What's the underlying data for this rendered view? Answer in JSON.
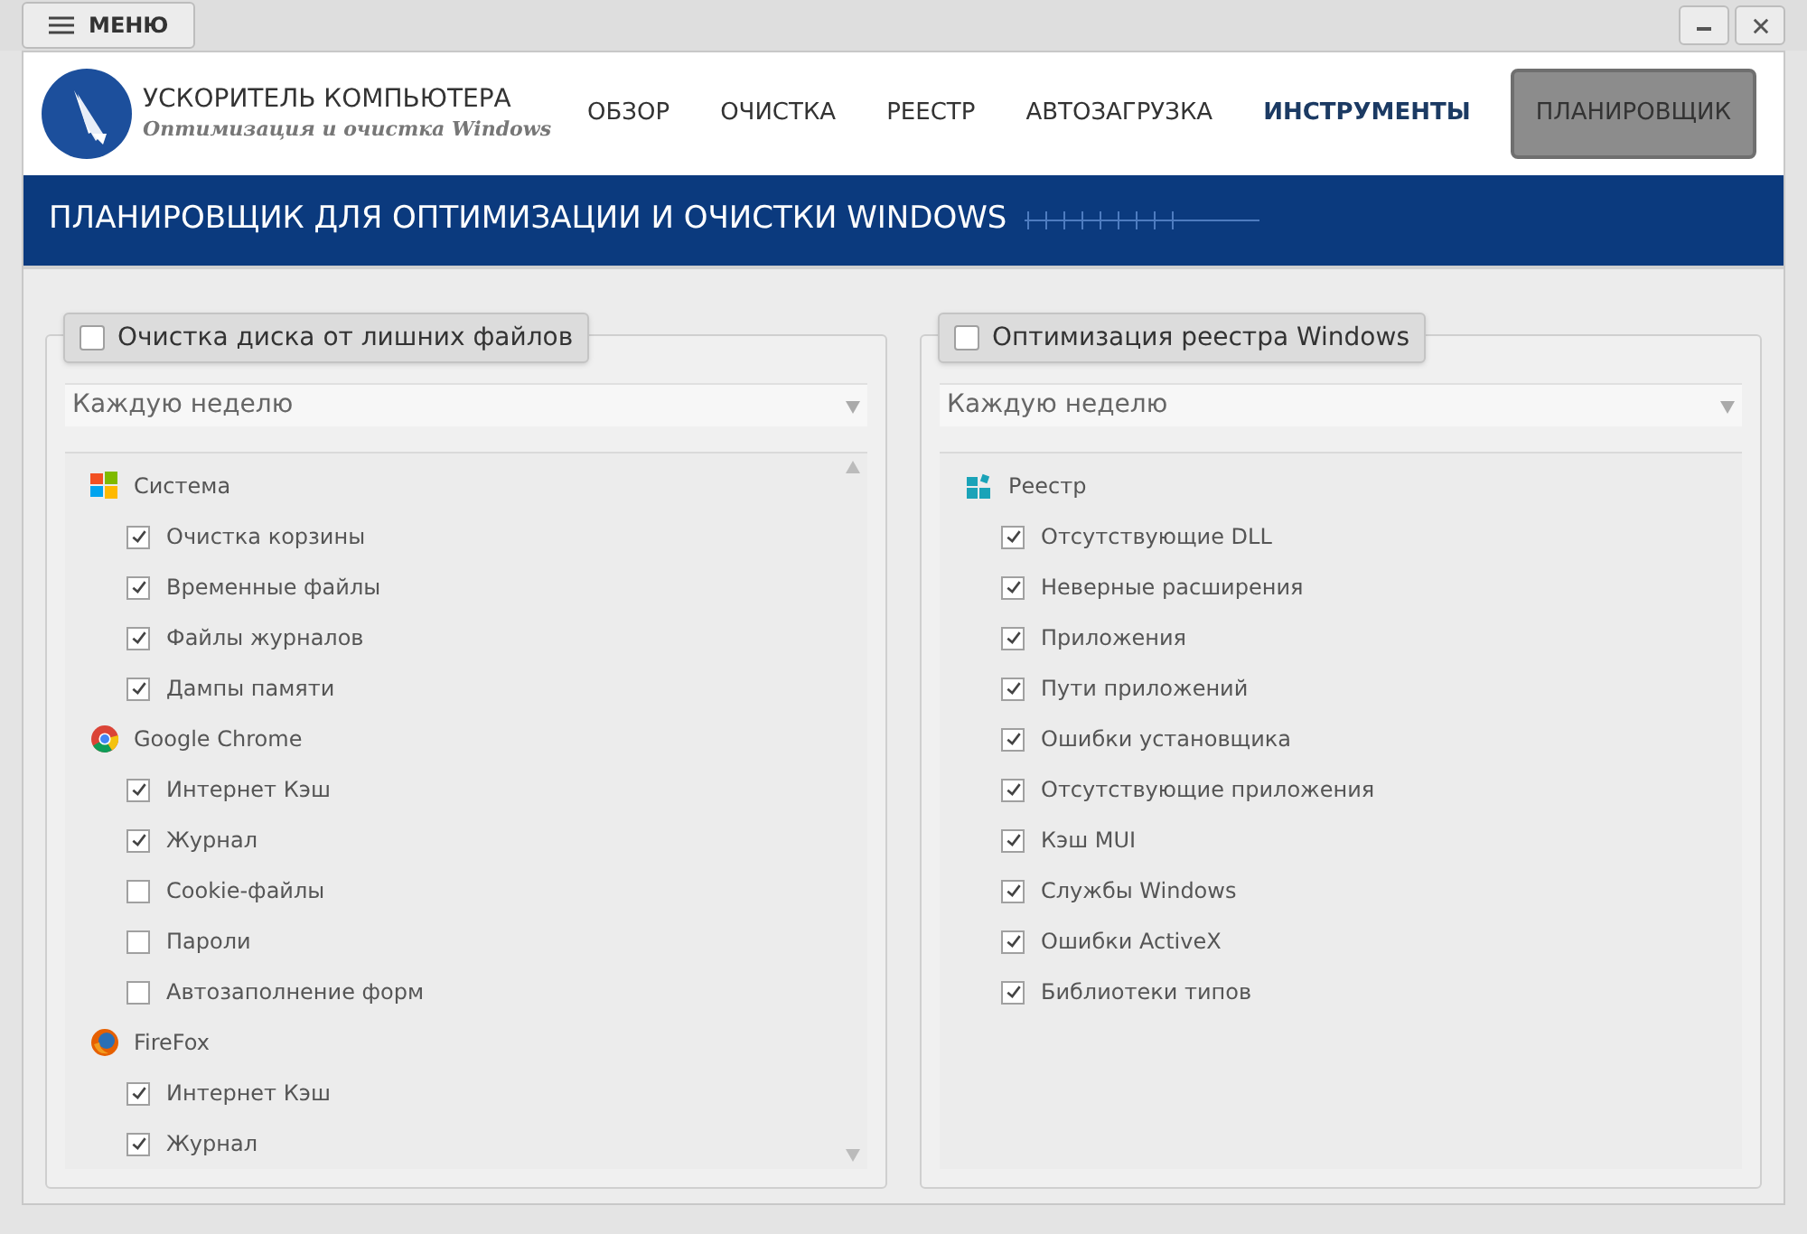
{
  "menu_button": {
    "label": "МЕНЮ"
  },
  "app": {
    "name": "УСКОРИТЕЛЬ КОМПЬЮТЕРА",
    "tagline": "Оптимизация и очистка Windows"
  },
  "nav": [
    {
      "label": "ОБЗОР",
      "selected": false,
      "highlighted": false
    },
    {
      "label": "ОЧИСТКА",
      "selected": false,
      "highlighted": false
    },
    {
      "label": "РЕЕСТР",
      "selected": false,
      "highlighted": false
    },
    {
      "label": "АВТОЗАГРУЗКА",
      "selected": false,
      "highlighted": false
    },
    {
      "label": "ИНСТРУМЕНТЫ",
      "selected": false,
      "highlighted": true
    },
    {
      "label": "ПЛАНИРОВЩИК",
      "selected": true,
      "highlighted": false
    }
  ],
  "banner": {
    "title": "ПЛАНИРОВЩИК ДЛЯ ОПТИМИЗАЦИИ И ОЧИСТКИ WINDOWS"
  },
  "panels": [
    {
      "title": "Очистка диска от лишних файлов",
      "checked": false,
      "schedule": "Каждую неделю",
      "scrollable": true,
      "groups": [
        {
          "name": "Система",
          "kind": "windows",
          "items": [
            {
              "label": "Очистка корзины",
              "checked": true
            },
            {
              "label": "Временные файлы",
              "checked": true
            },
            {
              "label": "Файлы журналов",
              "checked": true
            },
            {
              "label": "Дампы памяти",
              "checked": true
            }
          ]
        },
        {
          "name": "Google Chrome",
          "kind": "chrome",
          "items": [
            {
              "label": "Интернет Кэш",
              "checked": true
            },
            {
              "label": "Журнал",
              "checked": true
            },
            {
              "label": "Cookie-файлы",
              "checked": false
            },
            {
              "label": "Пароли",
              "checked": false
            },
            {
              "label": "Автозаполнение форм",
              "checked": false
            }
          ]
        },
        {
          "name": "FireFox",
          "kind": "firefox",
          "items": [
            {
              "label": "Интернет Кэш",
              "checked": true
            },
            {
              "label": "Журнал",
              "checked": true
            }
          ]
        }
      ]
    },
    {
      "title": "Оптимизация реестра Windows",
      "checked": false,
      "schedule": "Каждую неделю",
      "scrollable": false,
      "groups": [
        {
          "name": "Реестр",
          "kind": "registry",
          "items": [
            {
              "label": "Отсутствующие DLL",
              "checked": true
            },
            {
              "label": "Неверные расширения",
              "checked": true
            },
            {
              "label": "Приложения",
              "checked": true
            },
            {
              "label": "Пути приложений",
              "checked": true
            },
            {
              "label": "Ошибки установщика",
              "checked": true
            },
            {
              "label": "Отсутствующие приложения",
              "checked": true
            },
            {
              "label": "Кэш MUI",
              "checked": true
            },
            {
              "label": "Службы Windows",
              "checked": true
            },
            {
              "label": "Ошибки ActiveX",
              "checked": true
            },
            {
              "label": "Библиотеки типов",
              "checked": true
            }
          ]
        }
      ]
    }
  ]
}
